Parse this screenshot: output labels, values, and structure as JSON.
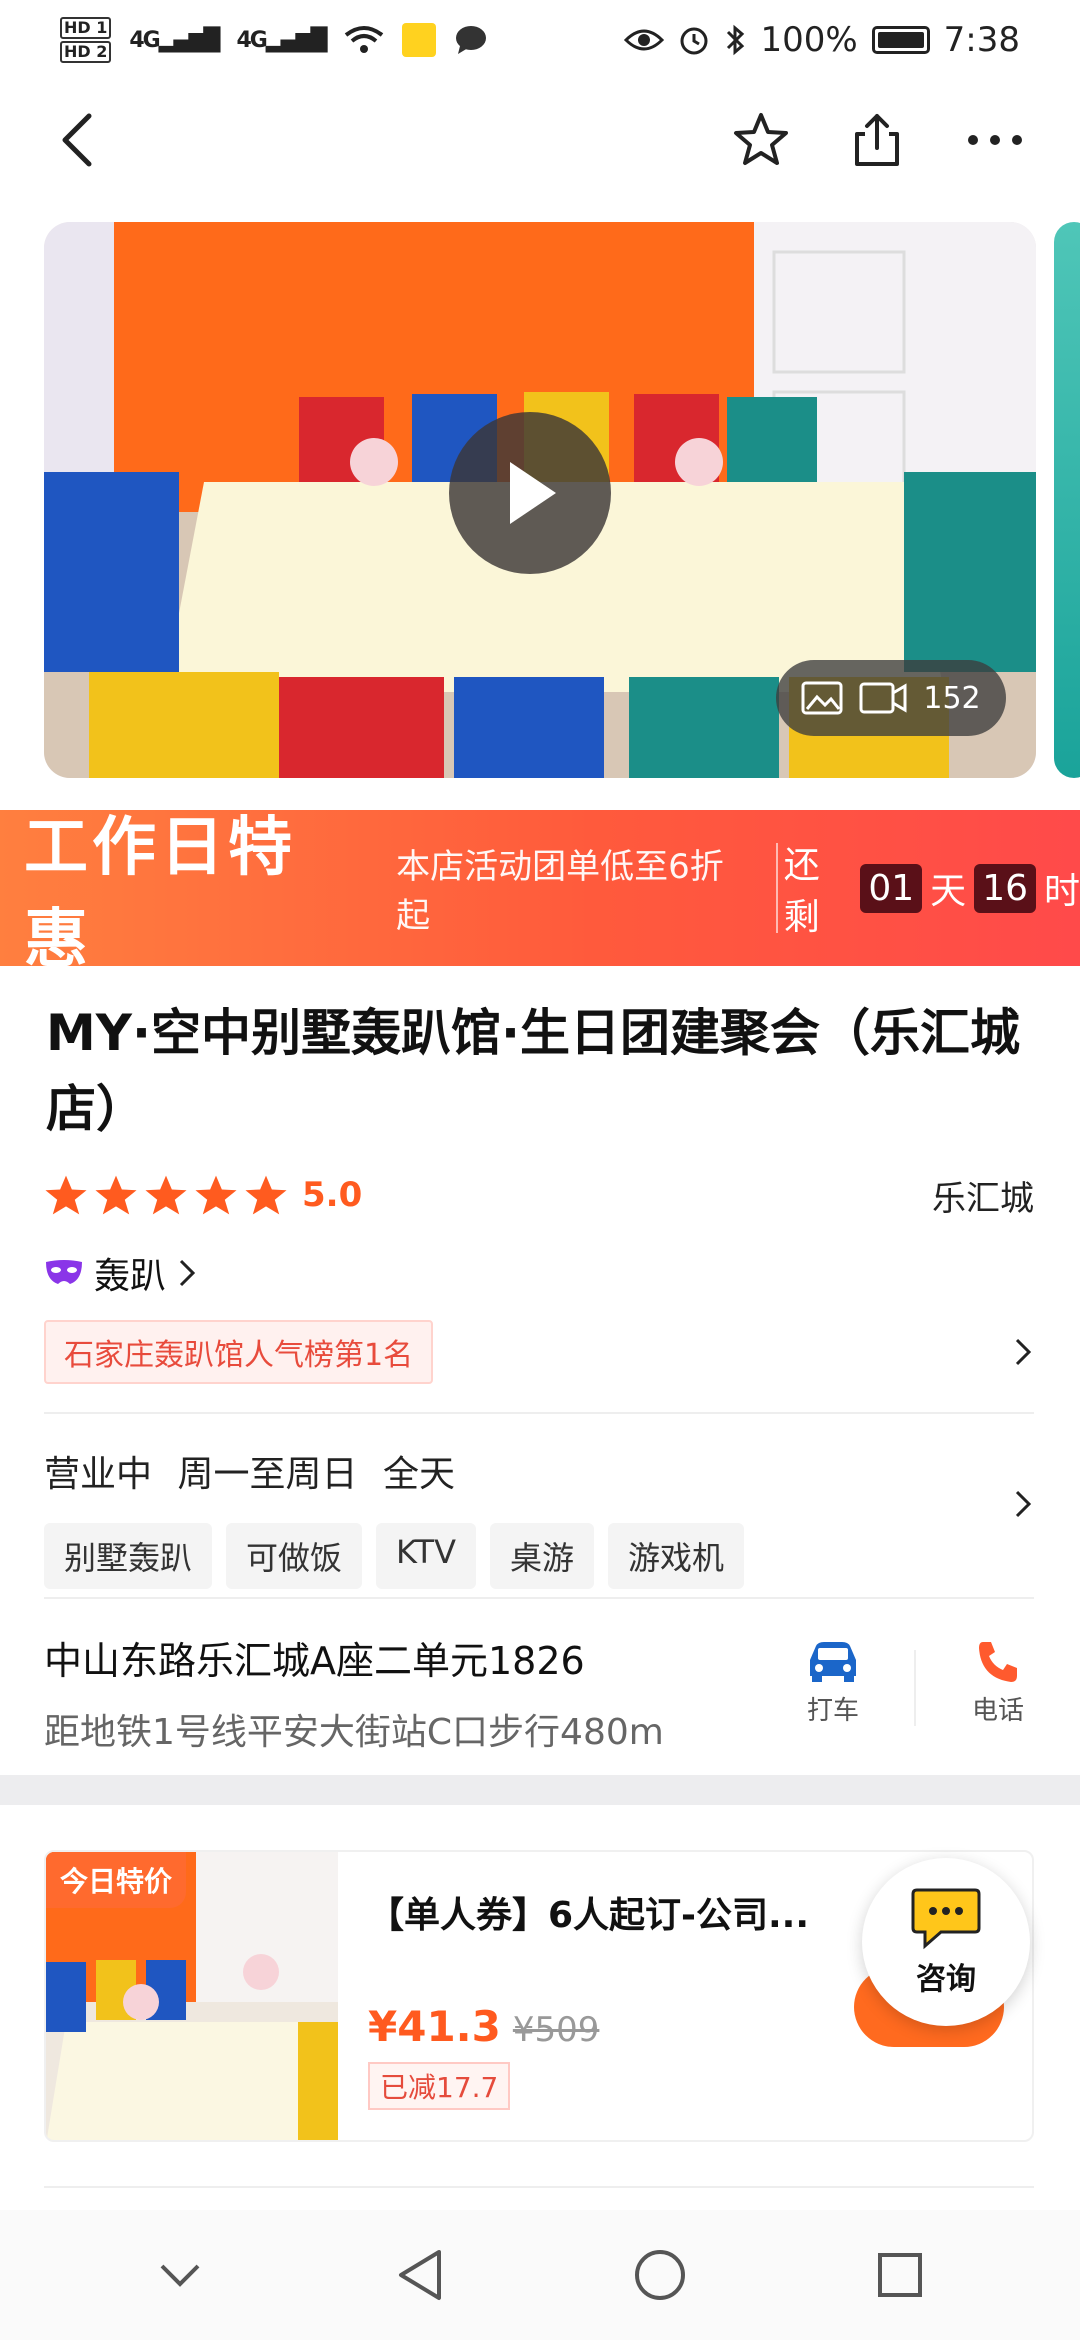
{
  "status_bar": {
    "hd1": "HD 1",
    "hd2": "HD 2",
    "sig1": "4G",
    "sig2": "4G",
    "battery": "100%",
    "time": "7:38"
  },
  "hero": {
    "media_count": "152"
  },
  "promo": {
    "title": "工作日特惠",
    "subtitle": "本店活动团单低至6折起",
    "remaining_label": "还剩",
    "days": "01",
    "days_unit": "天",
    "hours": "16",
    "hours_unit": "时"
  },
  "shop": {
    "title": "MY·空中别墅轰趴馆·生日团建聚会（乐汇城店）",
    "rating": "5.0",
    "area": "乐汇城",
    "category": "轰趴",
    "rank_tag": "石家庄轰趴馆人气榜第1名"
  },
  "hours": {
    "status": "营业中",
    "days": "周一至周日",
    "time": "全天",
    "tags": [
      "别墅轰趴",
      "可做饭",
      "KTV",
      "桌游",
      "游戏机"
    ]
  },
  "address": {
    "line1": "中山东路乐汇城A座二单元1826",
    "line2": "距地铁1号线平安大街站C口步行480m",
    "taxi_label": "打车",
    "phone_label": "电话"
  },
  "deal": {
    "badge": "今日特价",
    "title": "【单人券】6人起订-公司...",
    "price_now": "¥41.3",
    "price_old": "¥509",
    "reduce": "已减17.7"
  },
  "consult": {
    "label": "咨询"
  },
  "colors": {
    "accent": "#ff5a1f",
    "promo_start": "#ff7f3f",
    "promo_end": "#ff4a4a",
    "taxi_blue": "#1b66c9"
  }
}
